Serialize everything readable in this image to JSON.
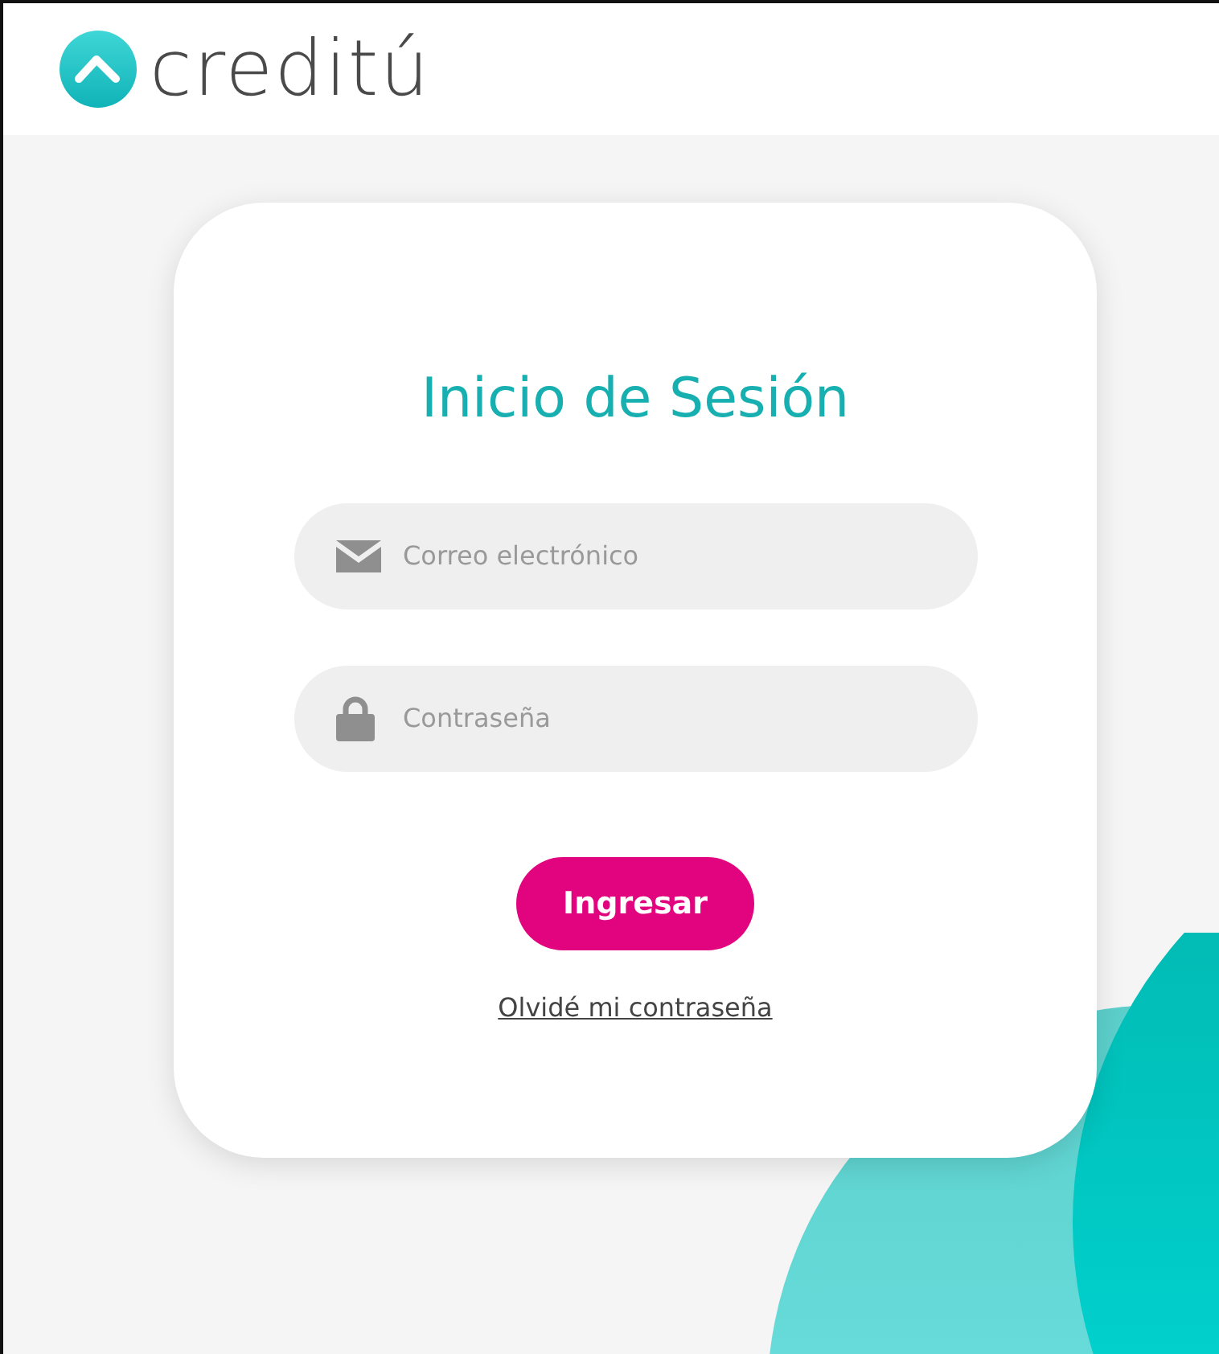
{
  "header": {
    "logo_text": "creditú"
  },
  "login": {
    "title": "Inicio de Sesión",
    "fields": [
      {
        "kind": "email",
        "placeholder": "Correo electrónico"
      },
      {
        "kind": "password",
        "placeholder": "Contraseña"
      }
    ],
    "submit": "Ingresar",
    "forgot_link": "Olvidé mi contraseña"
  }
}
